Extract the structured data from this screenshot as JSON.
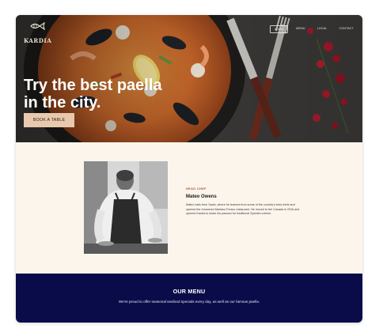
{
  "brand": {
    "name": "KARDIA",
    "logo_icon": "fish-icon"
  },
  "nav": {
    "items": [
      {
        "label": "HOME",
        "active": true
      },
      {
        "label": "MENU",
        "active": false
      },
      {
        "label": "LOCAL",
        "active": false
      },
      {
        "label": "CONTACT",
        "active": false
      }
    ]
  },
  "hero": {
    "title_line1": "Try the best paella",
    "title_line2": "in the city.",
    "cta_label": "BOOK A TABLE"
  },
  "chef": {
    "eyebrow": "HEAD CHEF",
    "name": "Mateo Owens",
    "bio": "Mateo hails from Spain, where he learned from some of the country's best chefs and opened the renowned Mariano Fresco restaurant. He moved to the Canada in 2016 and opened Kardia to share his passion for traditional Spanish cuisine."
  },
  "menu": {
    "title": "OUR MENU",
    "subtitle": "We're proud to offer seasonal seafood specials every day, as well as our famous paella."
  },
  "colors": {
    "cream": "#fbf5ec",
    "navy": "#0a0c4a",
    "cta": "#e8c9ae",
    "accent": "#b0502f"
  }
}
